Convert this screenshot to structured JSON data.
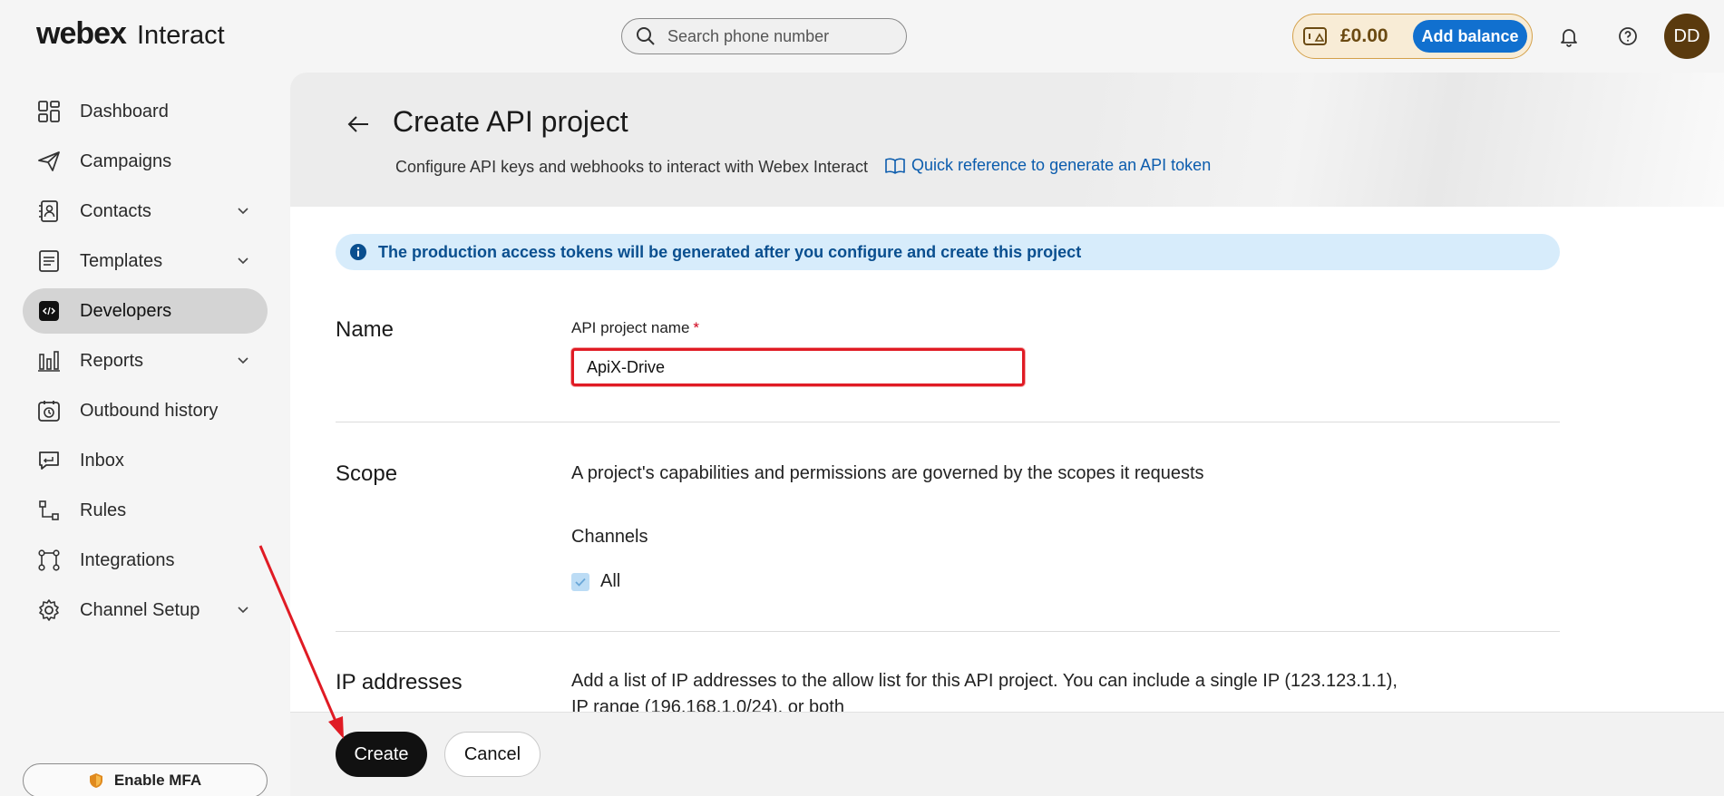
{
  "app": {
    "logo_brand": "webex",
    "logo_product": "Interact"
  },
  "topbar": {
    "search_placeholder": "Search phone number",
    "balance": "£0.00",
    "add_balance_label": "Add balance",
    "avatar_initials": "DD",
    "icons": [
      "wallet-icon",
      "bell-icon",
      "help-icon"
    ]
  },
  "sidebar": {
    "items": [
      {
        "label": "Dashboard",
        "icon": "dashboard-icon",
        "expandable": false,
        "active": false
      },
      {
        "label": "Campaigns",
        "icon": "paper-plane-icon",
        "expandable": false,
        "active": false
      },
      {
        "label": "Contacts",
        "icon": "contacts-icon",
        "expandable": true,
        "active": false
      },
      {
        "label": "Templates",
        "icon": "templates-icon",
        "expandable": true,
        "active": false
      },
      {
        "label": "Developers",
        "icon": "code-icon",
        "expandable": false,
        "active": true
      },
      {
        "label": "Reports",
        "icon": "bar-chart-icon",
        "expandable": true,
        "active": false
      },
      {
        "label": "Outbound history",
        "icon": "history-icon",
        "expandable": false,
        "active": false
      },
      {
        "label": "Inbox",
        "icon": "inbox-icon",
        "expandable": false,
        "active": false
      },
      {
        "label": "Rules",
        "icon": "rules-icon",
        "expandable": false,
        "active": false
      },
      {
        "label": "Integrations",
        "icon": "integrations-icon",
        "expandable": false,
        "active": false
      },
      {
        "label": "Channel Setup",
        "icon": "gear-icon",
        "expandable": true,
        "active": false
      }
    ],
    "mfa_label": "Enable MFA"
  },
  "page": {
    "title": "Create API project",
    "subtitle": "Configure API keys and webhooks to interact with Webex Interact",
    "quick_reference": "Quick reference to generate an API token",
    "info_banner": "The production access tokens will be generated after you configure and create this project",
    "name_section": {
      "title": "Name",
      "field_label": "API project name",
      "required_mark": "*",
      "value": "ApiX-Drive"
    },
    "scope_section": {
      "title": "Scope",
      "description": "A project's capabilities and permissions are governed by the scopes it requests",
      "channels_label": "Channels",
      "all_label": "All",
      "all_checked": true
    },
    "ip_section": {
      "title": "IP addresses",
      "description": "Add a list of IP addresses to the allow list for this API project. You can include a single IP (123.123.1.1), IP range (196.168.1.0/24), or both"
    }
  },
  "footer": {
    "create_label": "Create",
    "cancel_label": "Cancel"
  },
  "colors": {
    "accent_blue": "#1170cf",
    "link_blue": "#0b5cad",
    "annotation_red": "#e01b24",
    "balance_gold": "#d4a14b"
  }
}
